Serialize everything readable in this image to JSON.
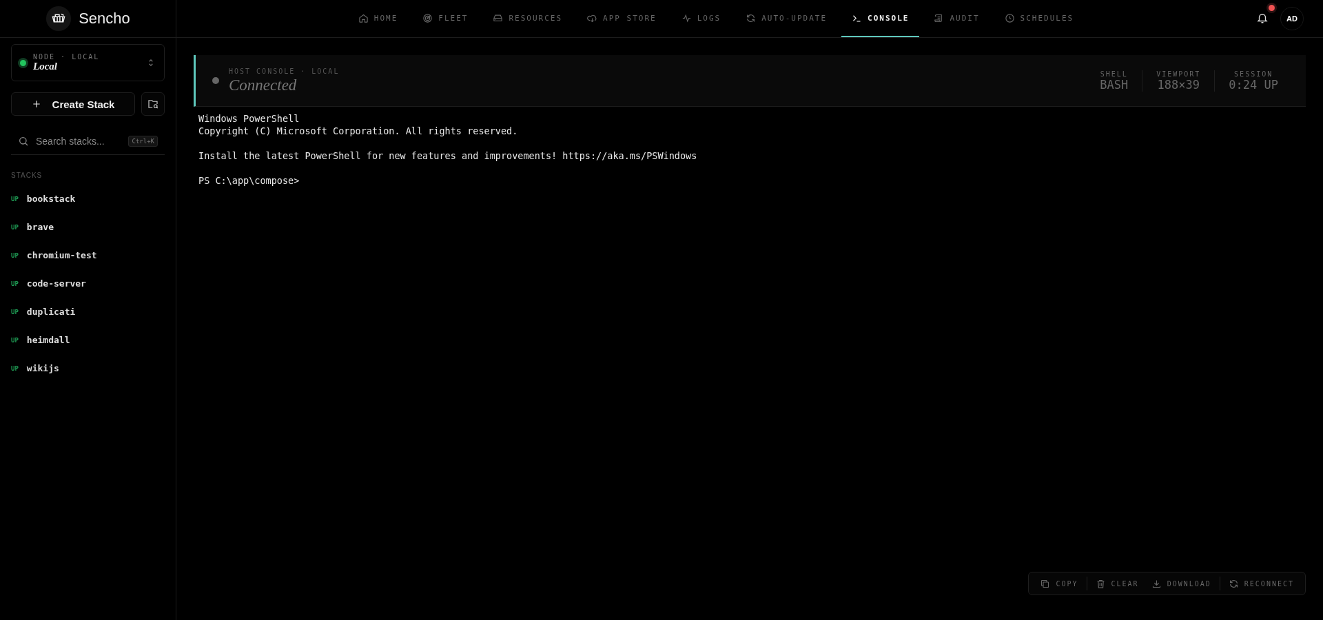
{
  "brand": {
    "name": "Sencho"
  },
  "nav": [
    {
      "label": "HOME",
      "kind": "home",
      "selected": false
    },
    {
      "label": "FLEET",
      "kind": "fleet",
      "selected": false
    },
    {
      "label": "RESOURCES",
      "kind": "resources",
      "selected": false
    },
    {
      "label": "APP STORE",
      "kind": "store",
      "selected": false
    },
    {
      "label": "LOGS",
      "kind": "logs",
      "selected": false
    },
    {
      "label": "AUTO-UPDATE",
      "kind": "update",
      "selected": false
    },
    {
      "label": "CONSOLE",
      "kind": "console",
      "selected": true
    },
    {
      "label": "AUDIT",
      "kind": "audit",
      "selected": false
    },
    {
      "label": "SCHEDULES",
      "kind": "schedules",
      "selected": false
    }
  ],
  "notifications": {
    "unread": true
  },
  "user": {
    "initials": "AD"
  },
  "node": {
    "caption": "NODE · LOCAL",
    "name": "Local",
    "online": true
  },
  "create_button": "Create Stack",
  "search": {
    "placeholder": "Search stacks...",
    "shortcut": "Ctrl+K"
  },
  "stacks_heading": "STACKS",
  "stacks": [
    {
      "status": "UP",
      "name": "bookstack"
    },
    {
      "status": "UP",
      "name": "brave"
    },
    {
      "status": "UP",
      "name": "chromium-test"
    },
    {
      "status": "UP",
      "name": "code-server"
    },
    {
      "status": "UP",
      "name": "duplicati"
    },
    {
      "status": "UP",
      "name": "heimdall"
    },
    {
      "status": "UP",
      "name": "wikijs"
    }
  ],
  "console": {
    "caption": "HOST CONSOLE · LOCAL",
    "status": "Connected",
    "stats": [
      {
        "label": "SHELL",
        "value": "BASH"
      },
      {
        "label": "VIEWPORT",
        "value": "188×39"
      },
      {
        "label": "SESSION",
        "value": "0:24 UP"
      }
    ],
    "output_blocks": [
      [
        "Windows PowerShell",
        "Copyright (C) Microsoft Corporation. All rights reserved."
      ],
      [
        "Install the latest PowerShell for new features and improvements! https://aka.ms/PSWindows"
      ],
      [
        "PS C:\\app\\compose>"
      ]
    ]
  },
  "actions": [
    {
      "label": "COPY",
      "kind": "copy"
    },
    {
      "label": "CLEAR",
      "kind": "clear"
    },
    {
      "label": "DOWNLOAD",
      "kind": "download"
    },
    {
      "label": "RECONNECT",
      "kind": "reconnect"
    }
  ]
}
